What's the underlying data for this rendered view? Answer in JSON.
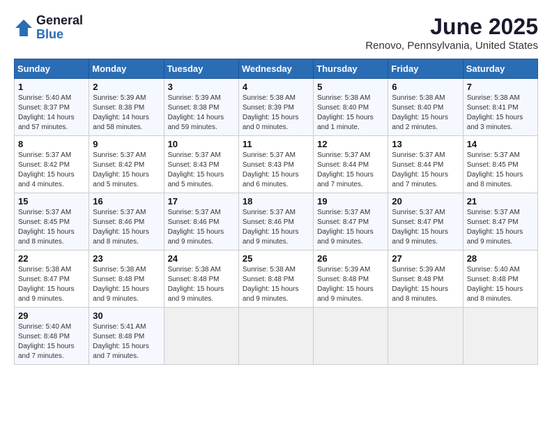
{
  "logo": {
    "general": "General",
    "blue": "Blue"
  },
  "title": {
    "month": "June 2025",
    "location": "Renovo, Pennsylvania, United States"
  },
  "weekdays": [
    "Sunday",
    "Monday",
    "Tuesday",
    "Wednesday",
    "Thursday",
    "Friday",
    "Saturday"
  ],
  "weeks": [
    [
      {
        "day": "1",
        "sunrise": "5:40 AM",
        "sunset": "8:37 PM",
        "daylight": "14 hours and 57 minutes."
      },
      {
        "day": "2",
        "sunrise": "5:39 AM",
        "sunset": "8:38 PM",
        "daylight": "14 hours and 58 minutes."
      },
      {
        "day": "3",
        "sunrise": "5:39 AM",
        "sunset": "8:38 PM",
        "daylight": "14 hours and 59 minutes."
      },
      {
        "day": "4",
        "sunrise": "5:38 AM",
        "sunset": "8:39 PM",
        "daylight": "15 hours and 0 minutes."
      },
      {
        "day": "5",
        "sunrise": "5:38 AM",
        "sunset": "8:40 PM",
        "daylight": "15 hours and 1 minute."
      },
      {
        "day": "6",
        "sunrise": "5:38 AM",
        "sunset": "8:40 PM",
        "daylight": "15 hours and 2 minutes."
      },
      {
        "day": "7",
        "sunrise": "5:38 AM",
        "sunset": "8:41 PM",
        "daylight": "15 hours and 3 minutes."
      }
    ],
    [
      {
        "day": "8",
        "sunrise": "5:37 AM",
        "sunset": "8:42 PM",
        "daylight": "15 hours and 4 minutes."
      },
      {
        "day": "9",
        "sunrise": "5:37 AM",
        "sunset": "8:42 PM",
        "daylight": "15 hours and 5 minutes."
      },
      {
        "day": "10",
        "sunrise": "5:37 AM",
        "sunset": "8:43 PM",
        "daylight": "15 hours and 5 minutes."
      },
      {
        "day": "11",
        "sunrise": "5:37 AM",
        "sunset": "8:43 PM",
        "daylight": "15 hours and 6 minutes."
      },
      {
        "day": "12",
        "sunrise": "5:37 AM",
        "sunset": "8:44 PM",
        "daylight": "15 hours and 7 minutes."
      },
      {
        "day": "13",
        "sunrise": "5:37 AM",
        "sunset": "8:44 PM",
        "daylight": "15 hours and 7 minutes."
      },
      {
        "day": "14",
        "sunrise": "5:37 AM",
        "sunset": "8:45 PM",
        "daylight": "15 hours and 8 minutes."
      }
    ],
    [
      {
        "day": "15",
        "sunrise": "5:37 AM",
        "sunset": "8:45 PM",
        "daylight": "15 hours and 8 minutes."
      },
      {
        "day": "16",
        "sunrise": "5:37 AM",
        "sunset": "8:46 PM",
        "daylight": "15 hours and 8 minutes."
      },
      {
        "day": "17",
        "sunrise": "5:37 AM",
        "sunset": "8:46 PM",
        "daylight": "15 hours and 9 minutes."
      },
      {
        "day": "18",
        "sunrise": "5:37 AM",
        "sunset": "8:46 PM",
        "daylight": "15 hours and 9 minutes."
      },
      {
        "day": "19",
        "sunrise": "5:37 AM",
        "sunset": "8:47 PM",
        "daylight": "15 hours and 9 minutes."
      },
      {
        "day": "20",
        "sunrise": "5:37 AM",
        "sunset": "8:47 PM",
        "daylight": "15 hours and 9 minutes."
      },
      {
        "day": "21",
        "sunrise": "5:37 AM",
        "sunset": "8:47 PM",
        "daylight": "15 hours and 9 minutes."
      }
    ],
    [
      {
        "day": "22",
        "sunrise": "5:38 AM",
        "sunset": "8:47 PM",
        "daylight": "15 hours and 9 minutes."
      },
      {
        "day": "23",
        "sunrise": "5:38 AM",
        "sunset": "8:48 PM",
        "daylight": "15 hours and 9 minutes."
      },
      {
        "day": "24",
        "sunrise": "5:38 AM",
        "sunset": "8:48 PM",
        "daylight": "15 hours and 9 minutes."
      },
      {
        "day": "25",
        "sunrise": "5:38 AM",
        "sunset": "8:48 PM",
        "daylight": "15 hours and 9 minutes."
      },
      {
        "day": "26",
        "sunrise": "5:39 AM",
        "sunset": "8:48 PM",
        "daylight": "15 hours and 9 minutes."
      },
      {
        "day": "27",
        "sunrise": "5:39 AM",
        "sunset": "8:48 PM",
        "daylight": "15 hours and 8 minutes."
      },
      {
        "day": "28",
        "sunrise": "5:40 AM",
        "sunset": "8:48 PM",
        "daylight": "15 hours and 8 minutes."
      }
    ],
    [
      {
        "day": "29",
        "sunrise": "5:40 AM",
        "sunset": "8:48 PM",
        "daylight": "15 hours and 7 minutes."
      },
      {
        "day": "30",
        "sunrise": "5:41 AM",
        "sunset": "8:48 PM",
        "daylight": "15 hours and 7 minutes."
      },
      null,
      null,
      null,
      null,
      null
    ]
  ]
}
